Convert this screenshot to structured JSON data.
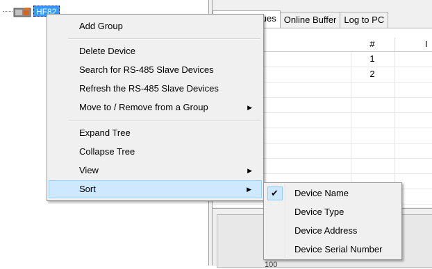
{
  "tree": {
    "node_label": "HF82"
  },
  "tabs": [
    {
      "label": "Current Values"
    },
    {
      "label": "Online Buffer"
    },
    {
      "label": "Log to PC"
    }
  ],
  "grid": {
    "header_num": "#",
    "header_extra": "I",
    "rows": [
      {
        "num": "1"
      },
      {
        "num": "2"
      },
      {
        "num": ""
      },
      {
        "num": ""
      },
      {
        "num": ""
      },
      {
        "num": ""
      },
      {
        "num": ""
      },
      {
        "num": ""
      },
      {
        "num": ""
      },
      {
        "num": ""
      }
    ]
  },
  "lower_panel": {
    "label": "100"
  },
  "context_menu": {
    "items": [
      {
        "label": "Add Group"
      },
      {
        "label": "Delete Device"
      },
      {
        "label": "Search for RS-485 Slave Devices"
      },
      {
        "label": "Refresh the RS-485 Slave Devices"
      },
      {
        "label": "Move to / Remove from a Group"
      },
      {
        "label": "Expand Tree"
      },
      {
        "label": "Collapse Tree"
      },
      {
        "label": "View"
      },
      {
        "label": "Sort"
      }
    ],
    "submenu_arrow": "▶"
  },
  "sort_submenu": {
    "checkmark": "✔",
    "items": [
      {
        "label": "Device Name",
        "checked": true
      },
      {
        "label": "Device Type",
        "checked": false
      },
      {
        "label": "Device Address",
        "checked": false
      },
      {
        "label": "Device Serial Number",
        "checked": false
      }
    ]
  },
  "colors": {
    "selection": "#3399ff",
    "menu_highlight": "#cde8ff",
    "menu_background": "#f0f0f0"
  }
}
